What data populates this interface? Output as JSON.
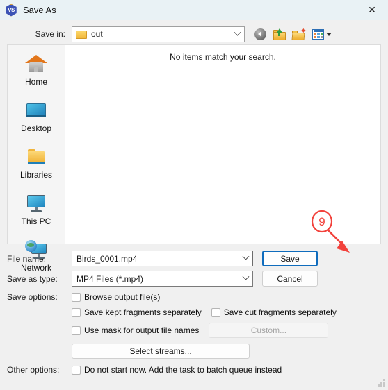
{
  "window": {
    "title": "Save As",
    "app_icon": "vs-icon",
    "app_icon_text": "VS",
    "close_label": "✕"
  },
  "savein": {
    "label": "Save in:",
    "value": "out",
    "folder_icon": "folder-icon",
    "chevron_icon": "chevron-down-icon"
  },
  "toolbar": {
    "back": "back-icon",
    "up": "up-folder-icon",
    "newfolder": "new-folder-icon",
    "views": "views-icon",
    "views_caret": "caret-down-icon"
  },
  "places": {
    "items": [
      {
        "label": "Home",
        "icon": "home-icon"
      },
      {
        "label": "Desktop",
        "icon": "desktop-icon"
      },
      {
        "label": "Libraries",
        "icon": "libraries-folder-icon"
      },
      {
        "label": "This PC",
        "icon": "this-pc-icon"
      },
      {
        "label": "Network",
        "icon": "network-icon"
      }
    ]
  },
  "filelist": {
    "empty_message": "No items match your search."
  },
  "form": {
    "filename_label": "File name:",
    "filename_value": "Birds_0001.mp4",
    "filetype_label": "Save as type:",
    "filetype_value": "MP4 Files (*.mp4)",
    "save_button": "Save",
    "cancel_button": "Cancel",
    "save_options_label": "Save options:",
    "other_options_label": "Other options:",
    "checkboxes": {
      "browse_output": "Browse output file(s)",
      "save_kept": "Save kept fragments separately",
      "save_cut": "Save cut fragments separately",
      "use_mask": "Use mask for output file names",
      "do_not_start": "Do not start now. Add the task to batch queue instead"
    },
    "custom_button": "Custom...",
    "select_streams_button": "Select streams..."
  },
  "annotation": {
    "step_number": "9",
    "color": "#f2423c"
  },
  "colors": {
    "titlebar_bg": "#e9f2f5",
    "dialog_bg": "#f0f0f0",
    "list_bg": "#ffffff",
    "accent_focus": "#0f6cbd",
    "annotation_red": "#f2423c"
  }
}
